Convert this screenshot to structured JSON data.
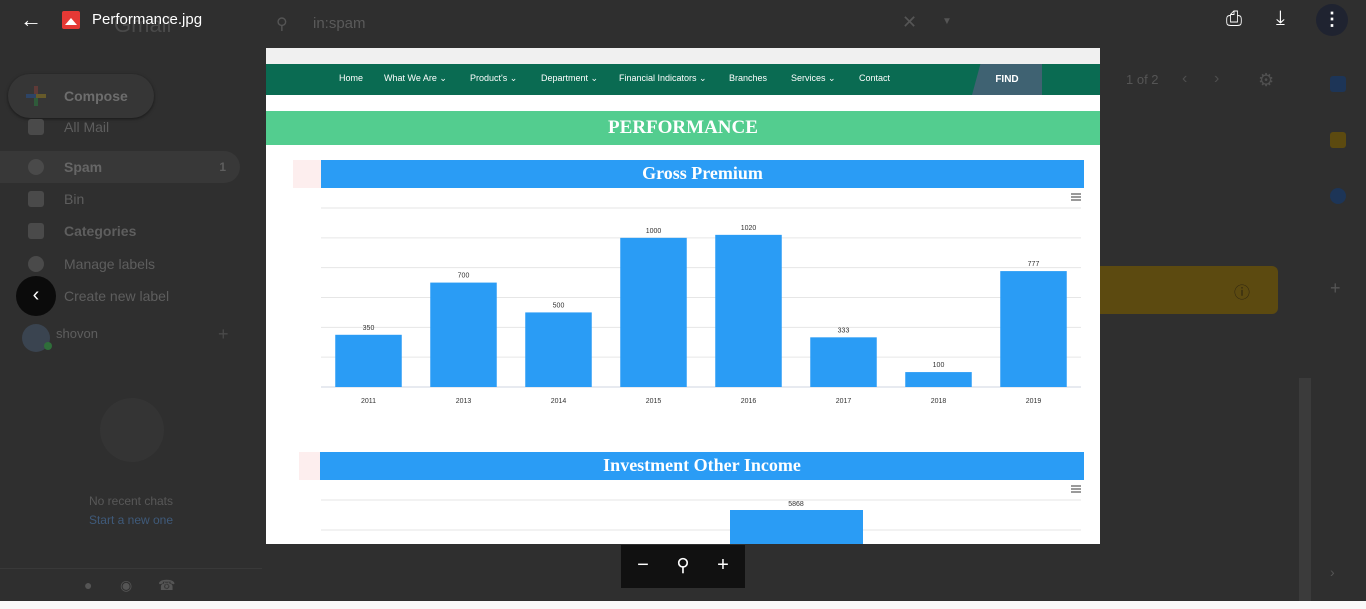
{
  "viewer": {
    "file_name": "Performance.jpg",
    "back_icon": "arrow-left-icon",
    "actions": [
      {
        "name": "print",
        "icon": "printer-icon"
      },
      {
        "name": "download",
        "icon": "download-icon"
      },
      {
        "name": "more",
        "icon": "more-vert-icon"
      }
    ]
  },
  "gmail": {
    "brand_word": "Gmail",
    "search_query": "in:spam",
    "compose_label": "Compose",
    "nav": [
      {
        "label": "All Mail",
        "count": ""
      },
      {
        "label": "Spam",
        "count": "1"
      },
      {
        "label": "Bin",
        "count": ""
      },
      {
        "label": "Categories",
        "count": ""
      },
      {
        "label": "Manage labels",
        "count": ""
      },
      {
        "label": "Create new label",
        "count": ""
      }
    ],
    "user_name": "shovon",
    "no_chats_text": "No recent chats",
    "start_chat_link": "Start a new one",
    "pager_text": "1 of 2"
  },
  "site": {
    "nav_items": [
      "Home",
      "What We Are",
      "Product's",
      "Department",
      "Financial Indicators",
      "Branches",
      "Services",
      "Contact"
    ],
    "find_label": "FIND",
    "section_title": "PERFORMANCE",
    "colors": {
      "nav_green": "#0a6b52",
      "band_green": "#53cd8f",
      "bar_blue": "#2a9cf5"
    }
  },
  "chart_data": [
    {
      "type": "bar",
      "title": "Gross Premium",
      "categories": [
        "2011",
        "2013",
        "2014",
        "2015",
        "2016",
        "2017",
        "2018",
        "2019"
      ],
      "values": [
        350,
        700,
        500,
        1000,
        1020,
        333,
        100,
        777
      ],
      "ylim": [
        0,
        1200
      ],
      "grid": true,
      "color": "#2a9cf5"
    },
    {
      "type": "bar",
      "title": "Investment Other Income",
      "categories": [],
      "values": [
        5868
      ],
      "grid": true,
      "color": "#2a9cf5"
    }
  ],
  "zoom": {
    "zoom_out_icon": "minus-icon",
    "reset_icon": "zoom-reset-icon",
    "zoom_in_icon": "plus-icon"
  }
}
